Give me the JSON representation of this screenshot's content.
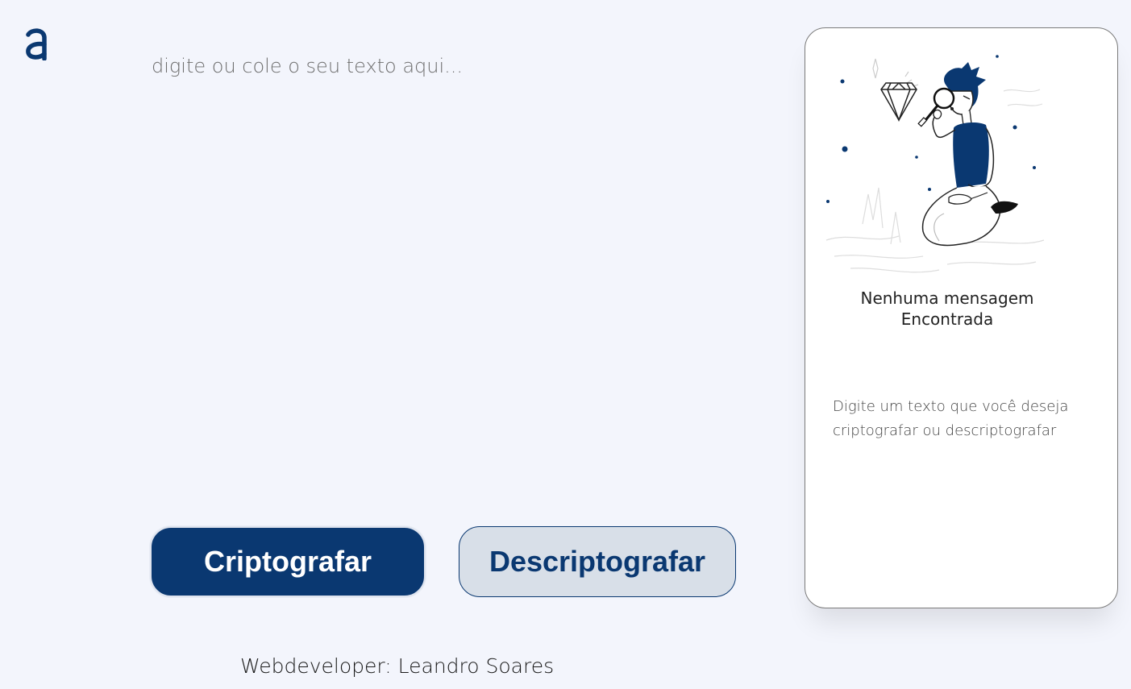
{
  "logo": {
    "icon": "alura-logo-icon",
    "color": "#0A3871"
  },
  "input": {
    "placeholder": "digite ou cole o seu texto aqui...",
    "value": ""
  },
  "buttons": {
    "encrypt_label": "Criptografar",
    "decrypt_label": "Descriptografar"
  },
  "footer": {
    "text": "Webdeveloper: Leandro Soares"
  },
  "output_panel": {
    "illustration_icon": "person-searching-magnifier-illustration",
    "title_line1": "Nenhuma mensagem",
    "title_line2": "Encontrada",
    "message_line1": "Digite um texto que você deseja",
    "message_line2": "criptografar ou descriptografar"
  },
  "colors": {
    "primary": "#0A3871",
    "background": "#F3F5FC",
    "secondary_button": "#D8DFE8",
    "card": "#FFFFFF"
  }
}
